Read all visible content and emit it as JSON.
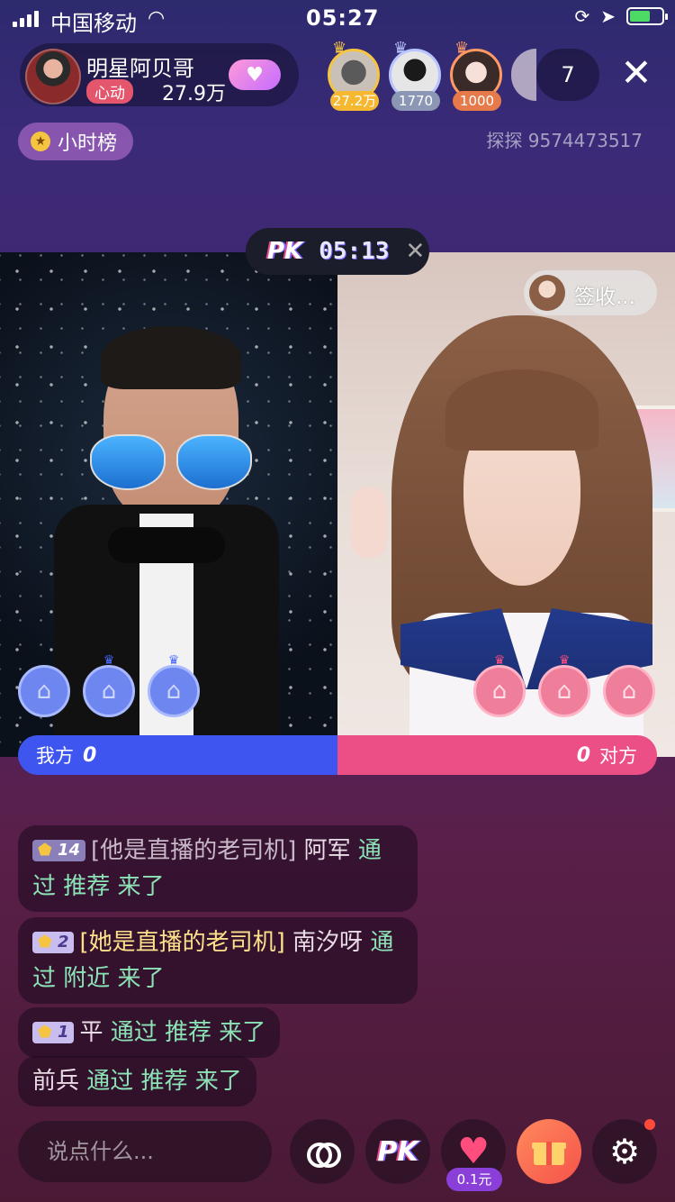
{
  "status": {
    "carrier": "中国移动",
    "time": "05:27"
  },
  "host": {
    "name": "明星阿贝哥",
    "tag": "心动",
    "followers": "27.9万"
  },
  "viewers": [
    {
      "badge": "27.2万",
      "color": "#f5c542"
    },
    {
      "badge": "1770",
      "color": "#b7c4ff"
    },
    {
      "badge": "1000",
      "color": "#ff9a63"
    }
  ],
  "viewer_count": "7",
  "hour_rank": "小时榜",
  "room_id": "探探 9574473517",
  "pk": {
    "logo": "PK",
    "time": "05:13"
  },
  "opponent_signer": "签收...",
  "pk_bar": {
    "mine_label": "我方",
    "mine_score": "0",
    "theirs_label": "对方",
    "theirs_score": "0"
  },
  "chat": [
    {
      "level": "14",
      "tag": "[他是直播的老司机]",
      "name": "阿军",
      "action": "通过 推荐 来了"
    },
    {
      "level": "2",
      "tag": "[她是直播的老司机]",
      "name": "南汐呀",
      "action": "通过 附近 来了"
    },
    {
      "level": "1",
      "name": "平",
      "action": "通过 推荐 来了"
    },
    {
      "name": "前兵",
      "action": "通过 推荐 来了"
    }
  ],
  "input_placeholder": "说点什么...",
  "bottom": {
    "pk_label": "PK",
    "price": "0.1元"
  }
}
